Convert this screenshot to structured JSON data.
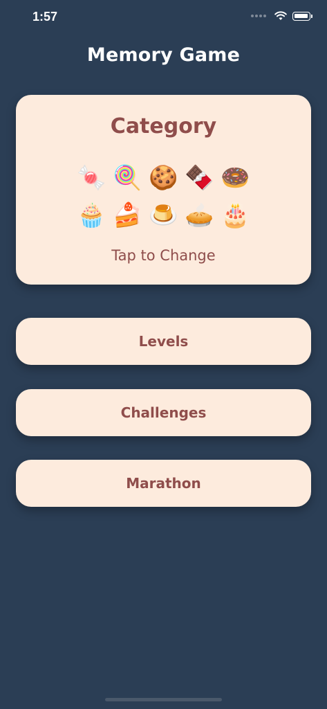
{
  "status_bar": {
    "time": "1:57",
    "icons": [
      "signal-icon",
      "wifi-icon",
      "battery-icon"
    ]
  },
  "nav": {
    "title": "Memory Game"
  },
  "category": {
    "title": "Category",
    "emojis_row1": [
      "🍬",
      "🍭",
      "🍪",
      "🍫",
      "🍩"
    ],
    "emojis_row2": [
      "🧁",
      "🍰",
      "🍮",
      "🥧",
      "🎂"
    ],
    "tap_label": "Tap to Change"
  },
  "menu": {
    "levels": "Levels",
    "challenges": "Challenges",
    "marathon": "Marathon"
  },
  "colors": {
    "background": "#2b3e55",
    "card": "#fdebdd",
    "accent_text": "#8f4d4b",
    "title_text": "#ffffff"
  }
}
